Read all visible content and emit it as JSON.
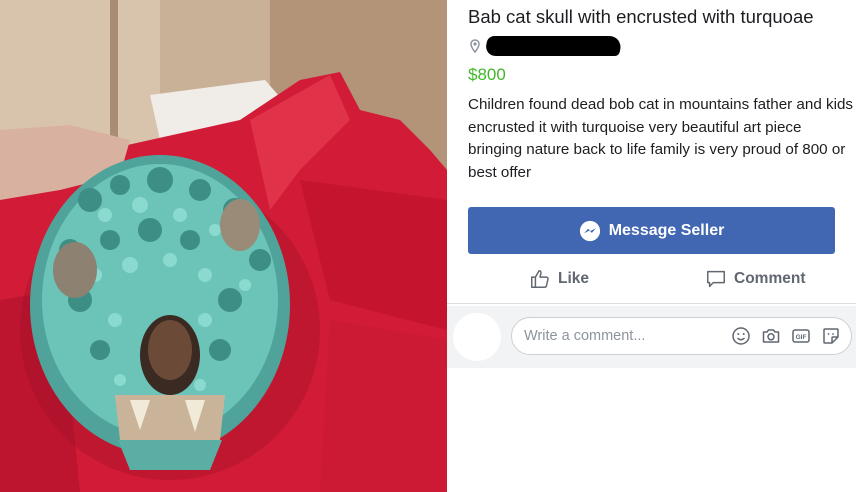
{
  "listing": {
    "title": "Bab cat skull with encrusted with turquoae",
    "price": "$800",
    "description": "Children found dead bob cat in mountains father and kids encrusted it with turquoise very beautiful art piece bringing nature back to life family is very proud of 800 or best offer"
  },
  "actions": {
    "message_seller": "Message Seller",
    "like": "Like",
    "comment": "Comment"
  },
  "comment_box": {
    "placeholder": "Write a comment..."
  },
  "icons": {
    "location": "location-pin-icon",
    "messenger": "messenger-icon",
    "like": "thumbs-up-icon",
    "comment": "speech-bubble-icon",
    "emoji": "smiley-icon",
    "camera": "camera-icon",
    "gif": "gif-icon",
    "sticker": "sticker-icon"
  },
  "colors": {
    "accent": "#4267b2",
    "price": "#42b72a",
    "text": "#1c1e21",
    "muted": "#606770"
  }
}
